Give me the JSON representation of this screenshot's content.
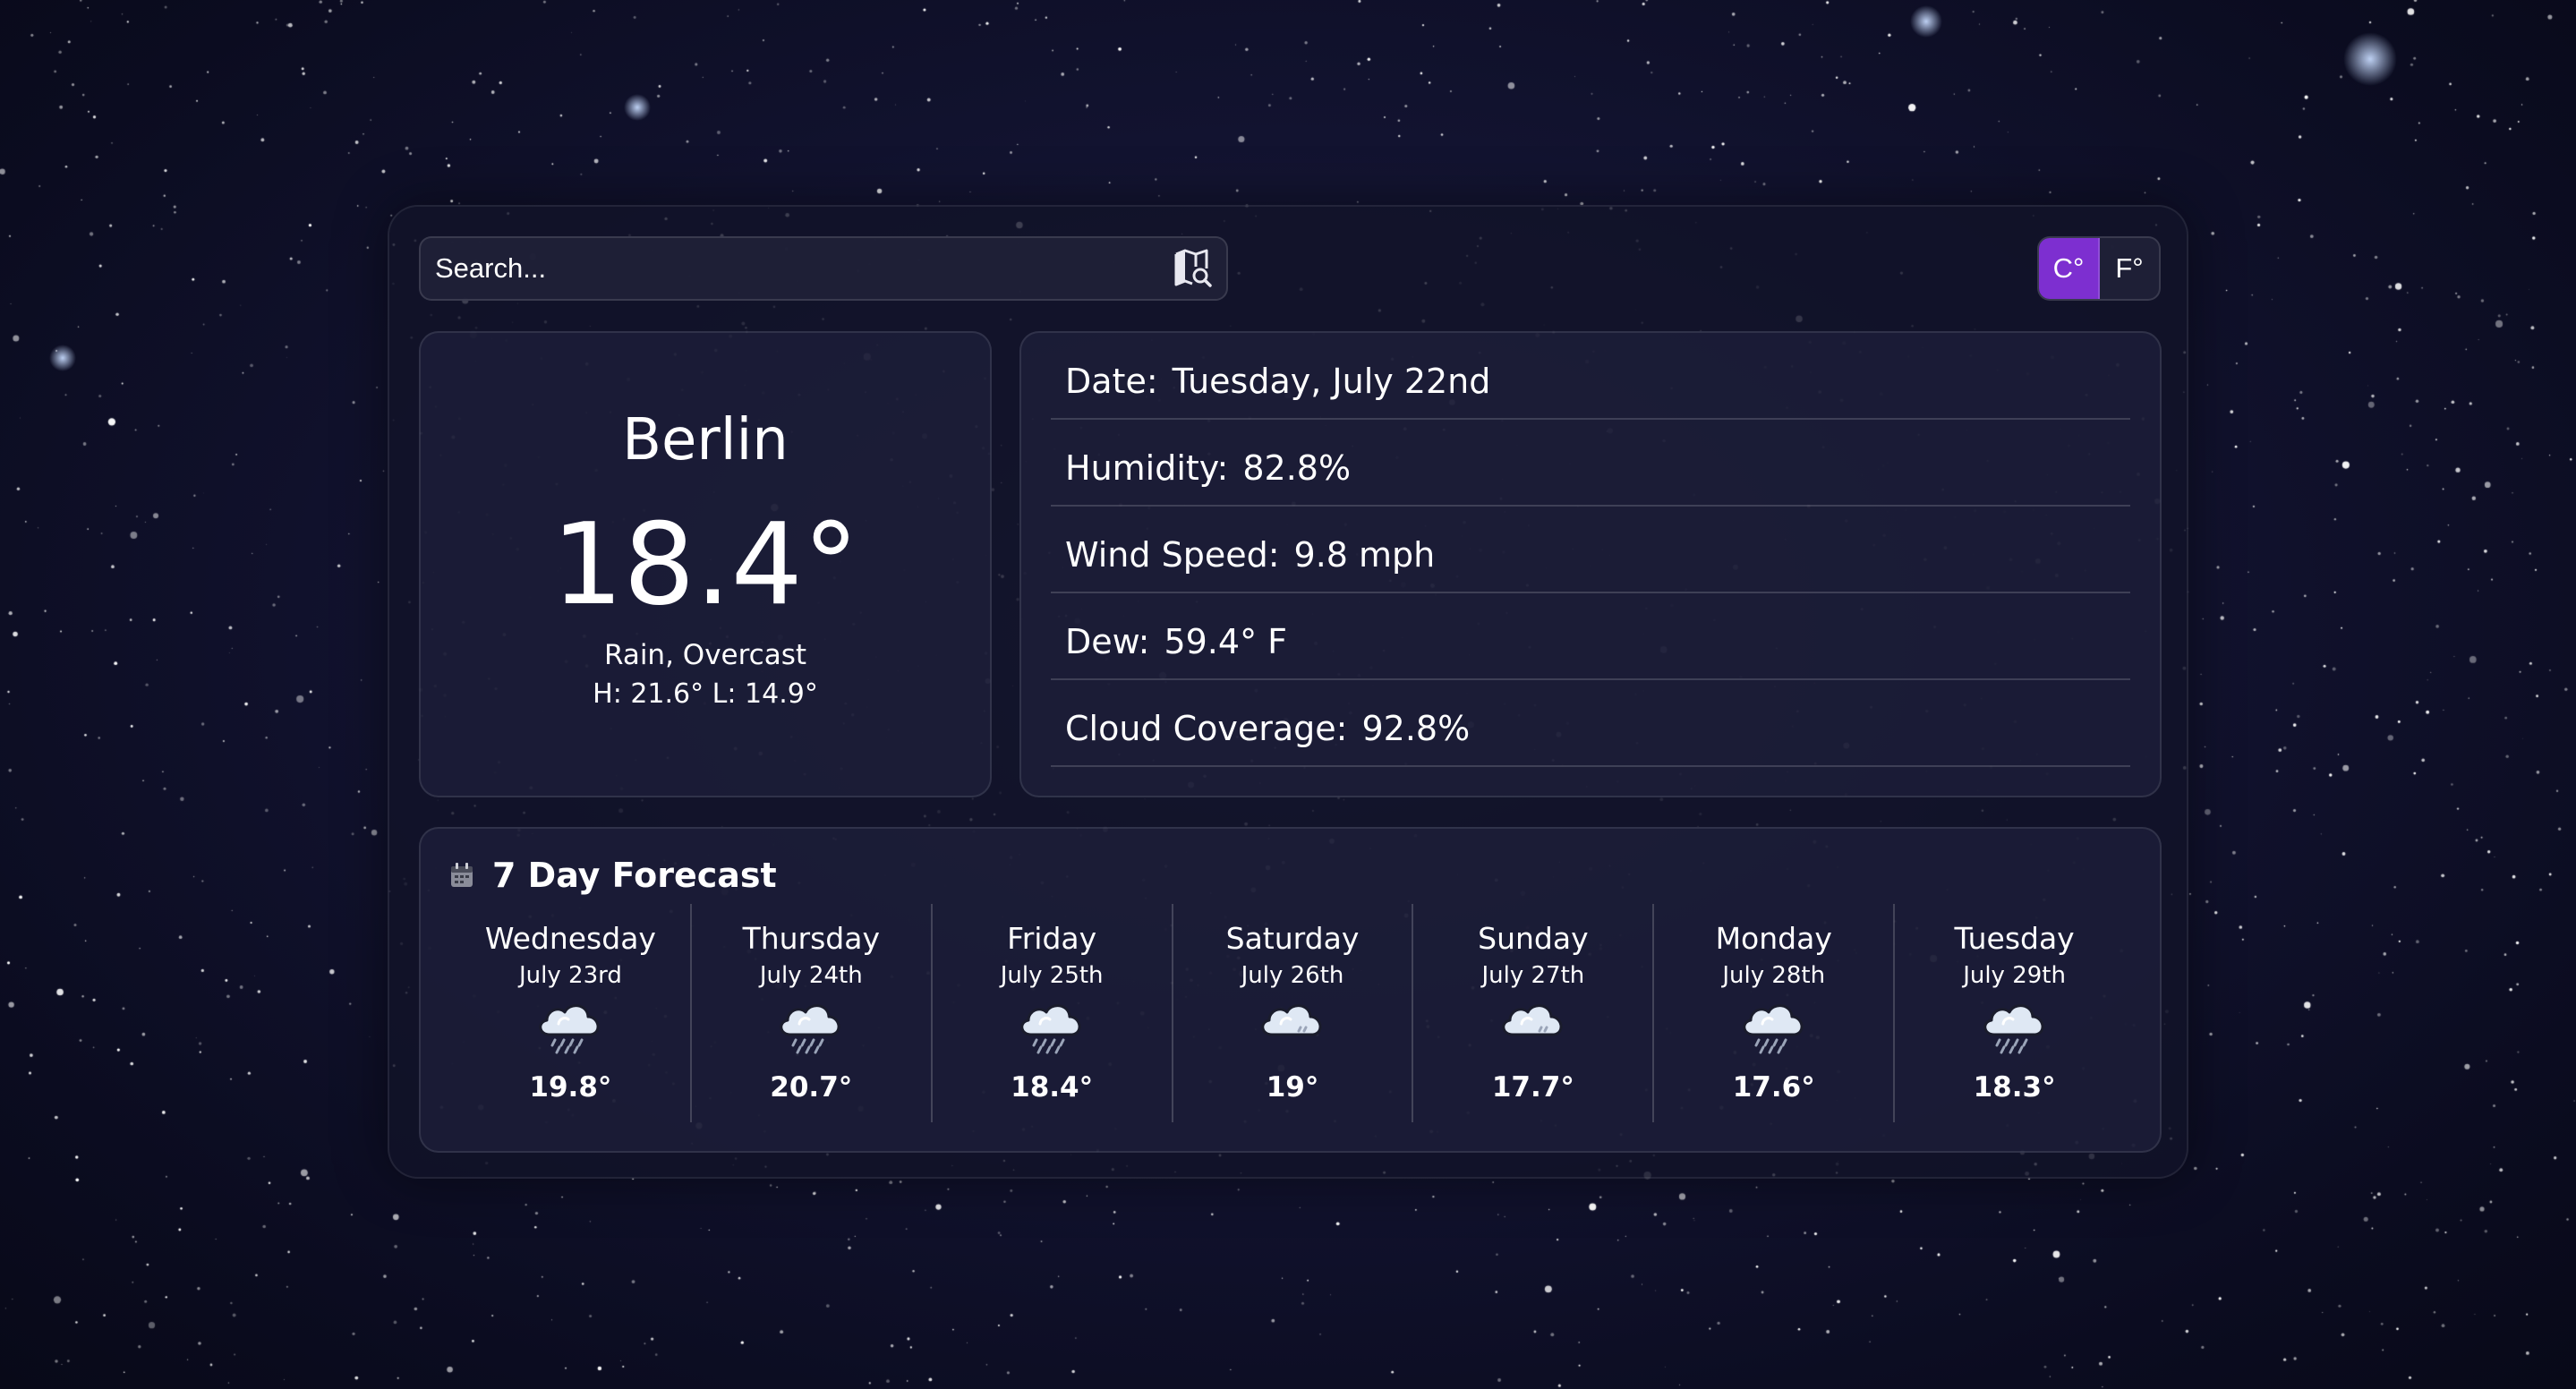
{
  "search": {
    "placeholder": "Search..."
  },
  "units": {
    "celsius_label": "C°",
    "fahrenheit_label": "F°",
    "active": "celsius"
  },
  "current": {
    "city": "Berlin",
    "temperature": "18.4°",
    "condition": "Rain, Overcast",
    "high_low": "H: 21.6°  L: 14.9°"
  },
  "details": [
    {
      "label": "Date:",
      "value": "Tuesday, July 22nd"
    },
    {
      "label": "Humidity:",
      "value": "82.8%"
    },
    {
      "label": "Wind Speed:",
      "value": "9.8 mph"
    },
    {
      "label": "Dew:",
      "value": "59.4° F"
    },
    {
      "label": "Cloud Coverage:",
      "value": "92.8%"
    }
  ],
  "forecast": {
    "title": "7 Day Forecast",
    "days": [
      {
        "name": "Wednesday",
        "date": "July 23rd",
        "icon": "rain-cloud-icon",
        "temp": "19.8°"
      },
      {
        "name": "Thursday",
        "date": "July 24th",
        "icon": "rain-cloud-icon",
        "temp": "20.7°"
      },
      {
        "name": "Friday",
        "date": "July 25th",
        "icon": "rain-cloud-icon",
        "temp": "18.4°"
      },
      {
        "name": "Saturday",
        "date": "July 26th",
        "icon": "drizzle-cloud-icon",
        "temp": "19°"
      },
      {
        "name": "Sunday",
        "date": "July 27th",
        "icon": "drizzle-cloud-icon",
        "temp": "17.7°"
      },
      {
        "name": "Monday",
        "date": "July 28th",
        "icon": "rain-cloud-icon",
        "temp": "17.6°"
      },
      {
        "name": "Tuesday",
        "date": "July 29th",
        "icon": "rain-cloud-icon",
        "temp": "18.3°"
      }
    ]
  },
  "colors": {
    "accent": "#7d2fd0",
    "background": "#0b0c20"
  }
}
